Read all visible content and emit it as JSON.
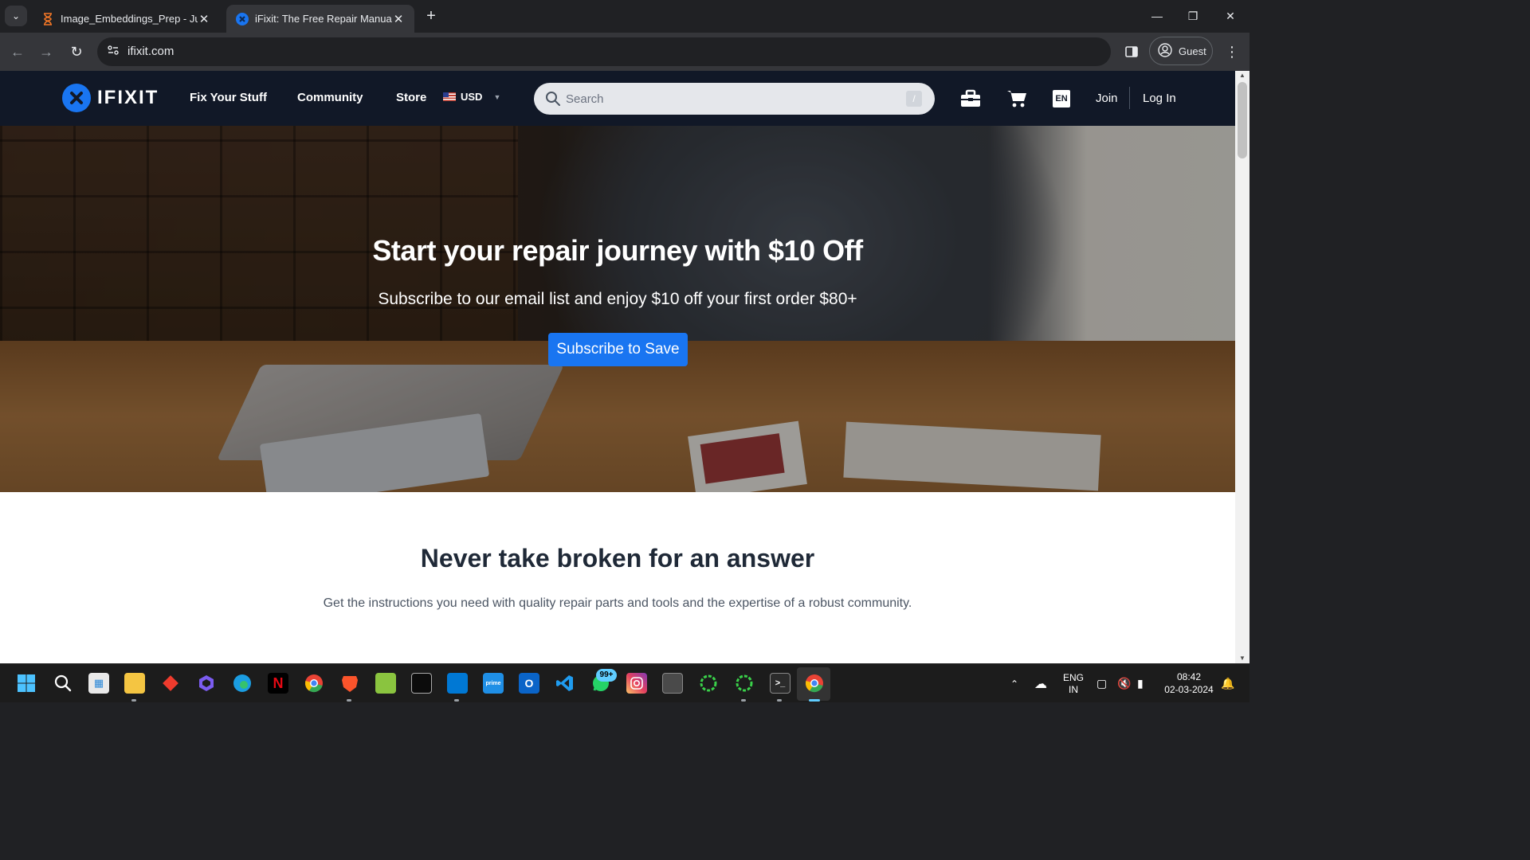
{
  "browser": {
    "tabs": [
      {
        "title": "Image_Embeddings_Prep - Jupy",
        "active": false
      },
      {
        "title": "iFixit: The Free Repair Manual",
        "active": true
      }
    ],
    "url": "ifixit.com",
    "profile_label": "Guest"
  },
  "site": {
    "logo_text": "IFIXIT",
    "nav": [
      "Fix Your Stuff",
      "Community",
      "Store"
    ],
    "currency": "USD",
    "search_placeholder": "Search",
    "search_shortcut": "/",
    "language": "EN",
    "join_label": "Join",
    "login_label": "Log In",
    "accent_color": "#1975f1"
  },
  "hero": {
    "headline": "Start your repair journey with $10 Off",
    "subhead": "Subscribe to our email list and enjoy $10 off your first order $80+",
    "cta": "Subscribe to Save"
  },
  "section": {
    "title": "Never take broken for an answer",
    "description": "Get the instructions you need with quality repair parts and tools and the expertise of a robust community."
  },
  "taskbar": {
    "apps": [
      "windows-start",
      "search",
      "widgets",
      "file-explorer",
      "anydesk",
      "copilot",
      "edge",
      "netflix",
      "chrome",
      "brave",
      "notepad-plus",
      "terminal-window",
      "app-store",
      "prime-video",
      "outlook",
      "vscode",
      "whatsapp",
      "instagram",
      "media-app",
      "circle-app-1",
      "circle-app-2",
      "cmd",
      "chrome-active"
    ],
    "whatsapp_badge": "99+",
    "language_line1": "ENG",
    "language_line2": "IN",
    "time": "08:42",
    "date": "02-03-2024"
  }
}
